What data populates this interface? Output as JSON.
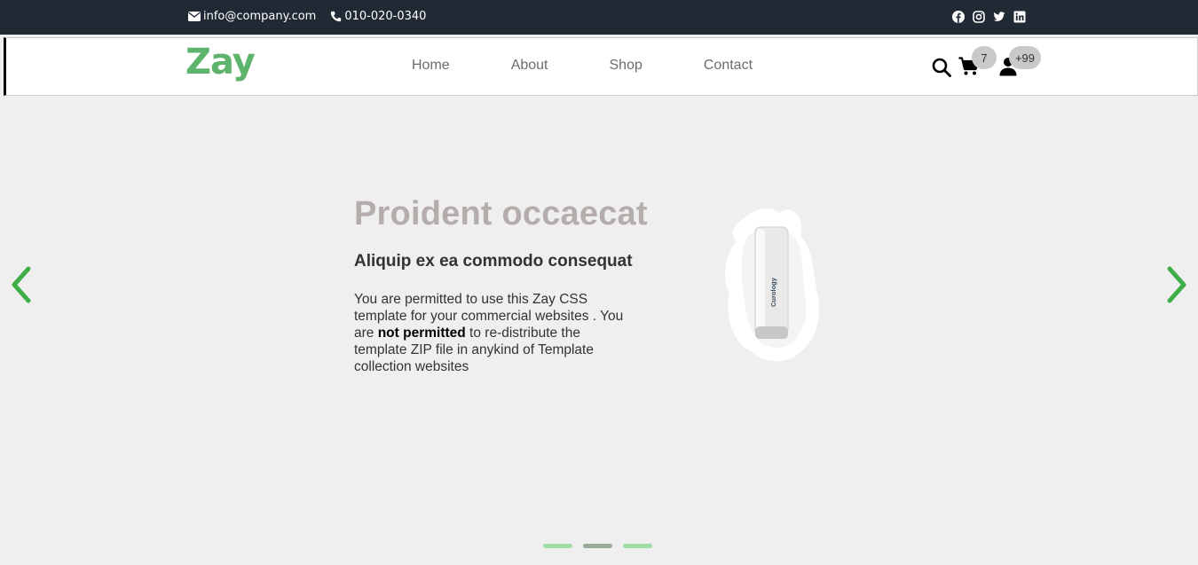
{
  "topbar": {
    "email": "info@company.com",
    "phone": "010-020-0340",
    "social": [
      "facebook-icon",
      "instagram-icon",
      "twitter-icon",
      "linkedin-icon"
    ]
  },
  "navbar": {
    "logo": "Zay",
    "menu": [
      "Home",
      "About",
      "Shop",
      "Contact"
    ],
    "cart_count": "7",
    "user_count": "+99"
  },
  "carousel": {
    "title": "Proident occaecat",
    "subtitle": "Aliquip ex ea commodo consequat",
    "text_part1": "You are permitted to use this Zay CSS template for your commercial websites . You are ",
    "text_bold": "not permitted",
    "text_part2": " to re-distribute the template ZIP file in anykind of Template collection websites",
    "product_label": "Curology",
    "slides": 3,
    "active_slide": 2
  },
  "colors": {
    "topbar_bg": "#212934",
    "brand": "#5fb46d",
    "arrow": "#3fae48",
    "title": "#b5adab",
    "indicator": "#9fdda7",
    "indicator_active": "#97aa99"
  }
}
